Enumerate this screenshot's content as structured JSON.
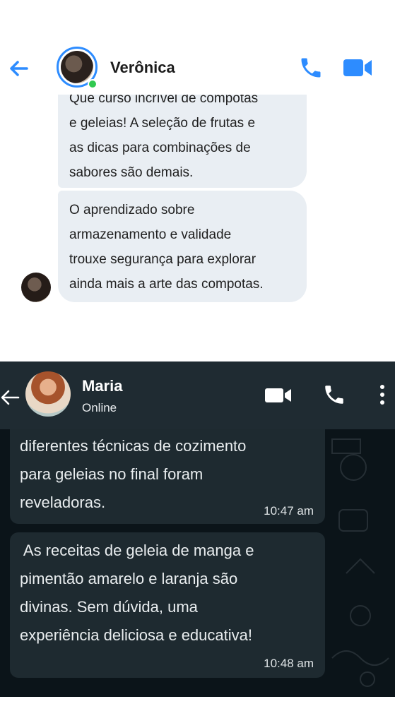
{
  "messenger": {
    "contact_name": "Verônica",
    "icons": {
      "back": "back-arrow-icon",
      "call": "phone-icon",
      "video": "video-camera-icon"
    },
    "accent": "#2d8cff",
    "online_color": "#31c950",
    "messages": [
      {
        "lines": [
          "Que curso incrível de compotas",
          "e geleias! A seleção de frutas e",
          "as dicas para combinações de",
          "sabores são demais."
        ]
      },
      {
        "lines": [
          "O aprendizado sobre",
          "armazenamento e validade",
          "trouxe segurança para explorar",
          "ainda mais a arte das compotas."
        ]
      }
    ]
  },
  "whatsapp": {
    "contact_name": "Maria",
    "status": "Online",
    "icons": {
      "back": "back-arrow-icon",
      "video": "video-camera-icon",
      "call": "phone-icon",
      "menu": "more-vertical-icon"
    },
    "header_color": "#1f2b32",
    "bubble_color": "#1e2a30",
    "messages": [
      {
        "lines": [
          "diferentes técnicas de cozimento",
          "para geleias no final foram",
          "reveladoras."
        ],
        "time": "10:47 am"
      },
      {
        "lines": [
          " As receitas de geleia de manga e",
          "pimentão amarelo e laranja são",
          "divinas. Sem dúvida, uma",
          "experiência deliciosa e educativa!"
        ],
        "time": "10:48 am"
      }
    ]
  }
}
